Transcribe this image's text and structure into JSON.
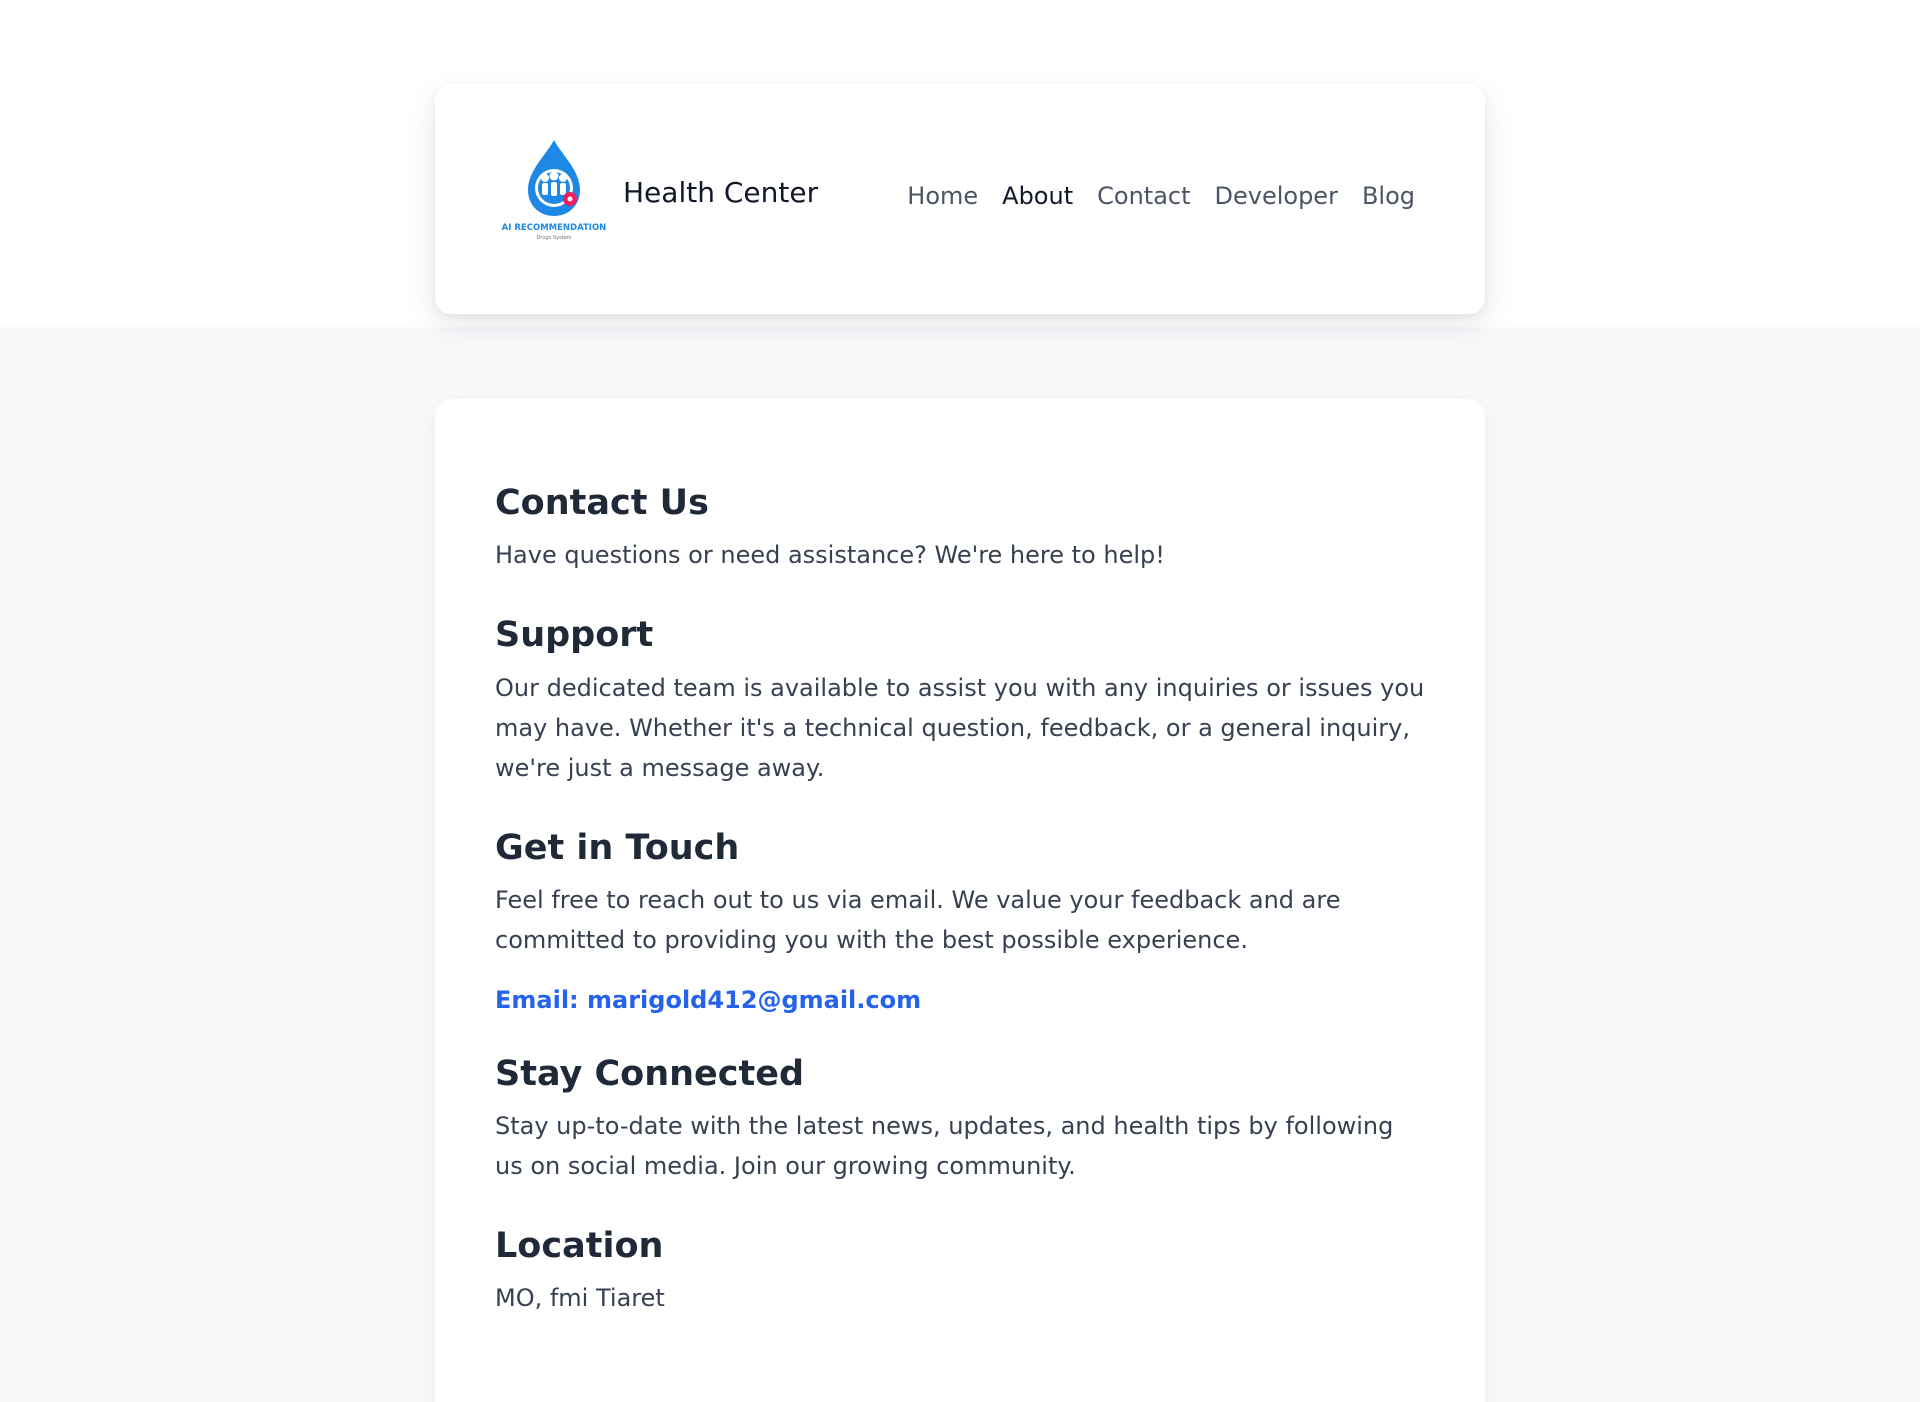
{
  "header": {
    "logo_text": "AI RECOMMENDATION",
    "logo_subtext": "Drugs System",
    "brand": "Health Center",
    "nav": [
      {
        "label": "Home"
      },
      {
        "label": "About"
      },
      {
        "label": "Contact"
      },
      {
        "label": "Developer"
      },
      {
        "label": "Blog"
      }
    ]
  },
  "content": {
    "contact_title": "Contact Us",
    "contact_text": "Have questions or need assistance? We're here to help!",
    "support_title": "Support",
    "support_text": "Our dedicated team is available to assist you with any inquiries or issues you may have. Whether it's a technical question, feedback, or a general inquiry, we're just a message away.",
    "touch_title": "Get in Touch",
    "touch_text": "Feel free to reach out to us via email. We value your feedback and are committed to providing you with the best possible experience.",
    "email": "Email: marigold412@gmail.com",
    "stay_title": "Stay Connected",
    "stay_text": "Stay up-to-date with the latest news, updates, and health tips by following us on social media. Join our growing community.",
    "location_title": "Location",
    "location_text": "MO, fmi Tiaret"
  },
  "colors": {
    "accent": "#2563eb",
    "logo_blue": "#1e88e5",
    "logo_pink": "#e91e63"
  }
}
